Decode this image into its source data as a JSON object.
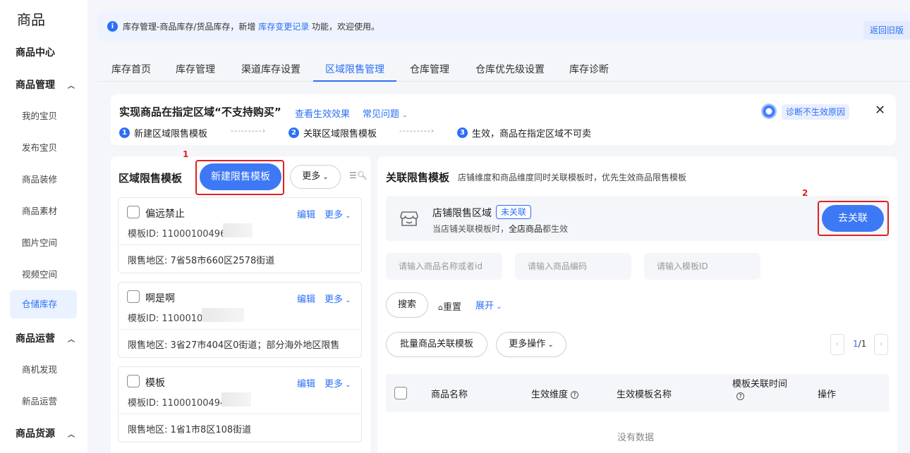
{
  "sidebar": {
    "title": "商品",
    "groups": [
      {
        "label": "商品中心"
      },
      {
        "label": "商品管理",
        "items": [
          "我的宝贝",
          "发布宝贝",
          "商品装修",
          "商品素材",
          "图片空间",
          "视频空间",
          "仓储库存"
        ]
      },
      {
        "label": "商品运营",
        "items": [
          "商机发现",
          "新品运营"
        ]
      },
      {
        "label": "商品货源"
      }
    ],
    "active_item": "仓储库存"
  },
  "notice": {
    "text_before": "库存管理-商品库存/货品库存，新增 ",
    "link": "库存变更记录",
    "text_after": " 功能，欢迎使用。",
    "back_label": "返回旧版"
  },
  "tabs": [
    "库存首页",
    "库存管理",
    "渠道库存设置",
    "区域限售管理",
    "仓库管理",
    "仓库优先级设置",
    "库存诊断"
  ],
  "active_tab": "区域限售管理",
  "banner": {
    "heading": "实现商品在指定区域“不支持购买”",
    "link_effect": "查看生效效果",
    "link_faq": "常见问题",
    "steps": [
      {
        "num": "1",
        "label": "新建区域限售模板"
      },
      {
        "num": "2",
        "label": "关联区域限售模板"
      },
      {
        "num": "3",
        "label": "生效，商品在指定区域不可卖"
      }
    ],
    "arrow": "---------›",
    "diagnose_label": "诊断不生效原因"
  },
  "left_panel": {
    "title": "区域限售模板",
    "annotation": "1",
    "new_button": "新建限售模板",
    "more_button": "更多",
    "templates": [
      {
        "name": "偏远禁止",
        "edit": "编辑",
        "more": "更多",
        "id_label": "模板ID: 11000100496",
        "area": "限售地区: 7省58市660区2578街道"
      },
      {
        "name": "啊是啊",
        "edit": "编辑",
        "more": "更多",
        "id_label": "模板ID: 110001004",
        "area": "限售地区: 3省27市404区0街道；部分海外地区限售"
      },
      {
        "name": "模板",
        "edit": "编辑",
        "more": "更多",
        "id_label": "模板ID: 110001004947",
        "area": "限售地区: 1省1市8区108街道"
      }
    ]
  },
  "right_panel": {
    "title": "关联限售模板",
    "subtitle": "店铺维度和商品维度同时关联模板时，优先生效商品限售模板",
    "annotation": "2",
    "shop": {
      "name": "店铺限售区域",
      "badge": "未关联",
      "desc_before": "当店铺关联模板时，",
      "desc_bold": "全店商品",
      "desc_after": "都生效",
      "link_button": "去关联"
    },
    "search": {
      "name_placeholder": "请输入商品名称或者id",
      "code_placeholder": "请输入商品编码",
      "template_placeholder": "请输入模板ID",
      "search_button": "搜索",
      "reset": "重置",
      "expand": "展开"
    },
    "batch_button": "批量商品关联模板",
    "more_ops_button": "更多操作",
    "pagination": {
      "current": "1",
      "total": "/1"
    },
    "table": {
      "columns": [
        "商品名称",
        "生效维度",
        "生效模板名称",
        "模板关联时间",
        "操作"
      ],
      "empty": "没有数据"
    }
  },
  "colors": {
    "accent": "#2b6ff5",
    "annotation": "#e0201e"
  }
}
